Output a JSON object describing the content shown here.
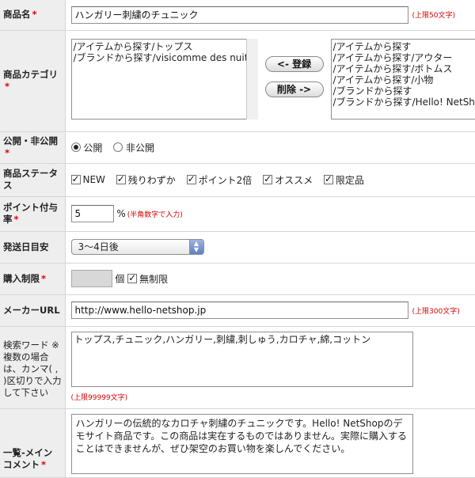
{
  "form": {
    "product_name": {
      "label": "商品名",
      "value": "ハンガリー刺繍のチュニック",
      "note": "(上限50文字)"
    },
    "category": {
      "label": "商品カテゴリ",
      "selected": [
        "/アイテムから探す/トップス",
        "/ブランドから探す/visicomme des nuits"
      ],
      "available": [
        "/アイテムから探す",
        "/アイテムから探す/アウター",
        "/アイテムから探す/ボトムス",
        "/アイテムから探す/小物",
        "/ブランドから探す",
        "/ブランドから探す/Hello! NetShop"
      ],
      "register_button": "<- 登録",
      "delete_button": "削除 ->"
    },
    "visibility": {
      "label": "公開・非公開",
      "options": [
        "公開",
        "非公開"
      ],
      "selected": "公開"
    },
    "status": {
      "label": "商品ステータス",
      "options": [
        "NEW",
        "残りわずか",
        "ポイント2倍",
        "オススメ",
        "限定品"
      ]
    },
    "points": {
      "label": "ポイント付与率",
      "value": "5",
      "unit": "%",
      "note": "(半角数字で入力)"
    },
    "shipping": {
      "label": "発送日目安",
      "selected": "3〜4日後"
    },
    "purchase_limit": {
      "label": "購入制限",
      "value": "",
      "unit": "個",
      "unlimited_label": "無制限"
    },
    "maker_url": {
      "label": "メーカーURL",
      "value": "http://www.hello-netshop.jp",
      "note": "(上限300文字)"
    },
    "search_words": {
      "label": "検索ワード ※複数の場合は、カンマ( , )区切りで入力して下さい",
      "value": "トップス,チュニック,ハンガリー,刺繍,刺しゅう,カロチャ,綿,コットン",
      "note": "(上限99999文字)"
    },
    "main_comment": {
      "label": "一覧-メインコメント",
      "value": "ハンガリーの伝統的なカロチャ刺繍のチュニックです。Hello! NetShopのデモサイト商品です。この商品は実在するものではありません。実際に購入することはできませんが、ぜひ架空のお買い物を楽しんでください。"
    },
    "required_mark": "*"
  }
}
